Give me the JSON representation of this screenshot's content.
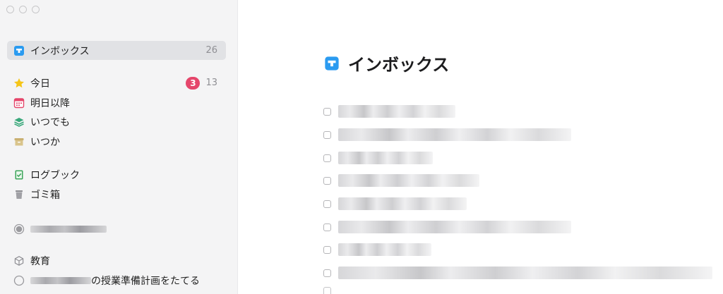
{
  "sidebar": {
    "items": [
      {
        "label": "インボックス",
        "count": "26",
        "icon": "inbox-icon"
      },
      {
        "label": "今日",
        "badge": "3",
        "count": "13",
        "icon": "star-icon"
      },
      {
        "label": "明日以降",
        "icon": "calendar-icon"
      },
      {
        "label": "いつでも",
        "icon": "layers-icon"
      },
      {
        "label": "いつか",
        "icon": "archive-box-icon"
      },
      {
        "label": "ログブック",
        "icon": "logbook-icon"
      },
      {
        "label": "ゴミ箱",
        "icon": "trash-icon"
      }
    ],
    "area_label": "教育",
    "project_label_suffix": "の授業準備計画をたてる"
  },
  "main": {
    "title": "インボックス",
    "title_icon": "inbox-icon"
  },
  "colors": {
    "accent_blue": "#2b9bf0",
    "today_star": "#f5c518",
    "badge_red": "#e5466b",
    "calendar_red": "#e5466b",
    "layers_green": "#3aa87b",
    "archive_tan": "#c9b071",
    "logbook_green": "#3da55a",
    "trash_gray": "#a0a0a5"
  }
}
